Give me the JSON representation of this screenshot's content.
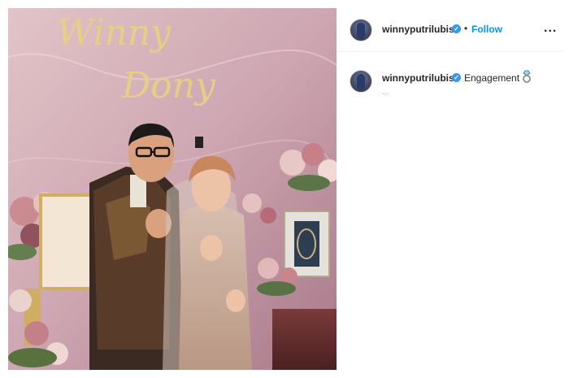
{
  "post": {
    "photo_alt": "Engagement photo",
    "backdrop_names": [
      "Winny",
      "Dony"
    ]
  },
  "header": {
    "username": "winnyputrilubis",
    "verified_mark": "✓",
    "separator": "•",
    "follow_label": "Follow",
    "more_label": "..."
  },
  "caption": {
    "username": "winnyputrilubis",
    "verified_mark": "✓",
    "text": "Engagement",
    "icon": "ring-icon",
    "sub": "..."
  },
  "colors": {
    "follow": "#0095f6",
    "verified": "#3897f0",
    "text": "#262626"
  }
}
